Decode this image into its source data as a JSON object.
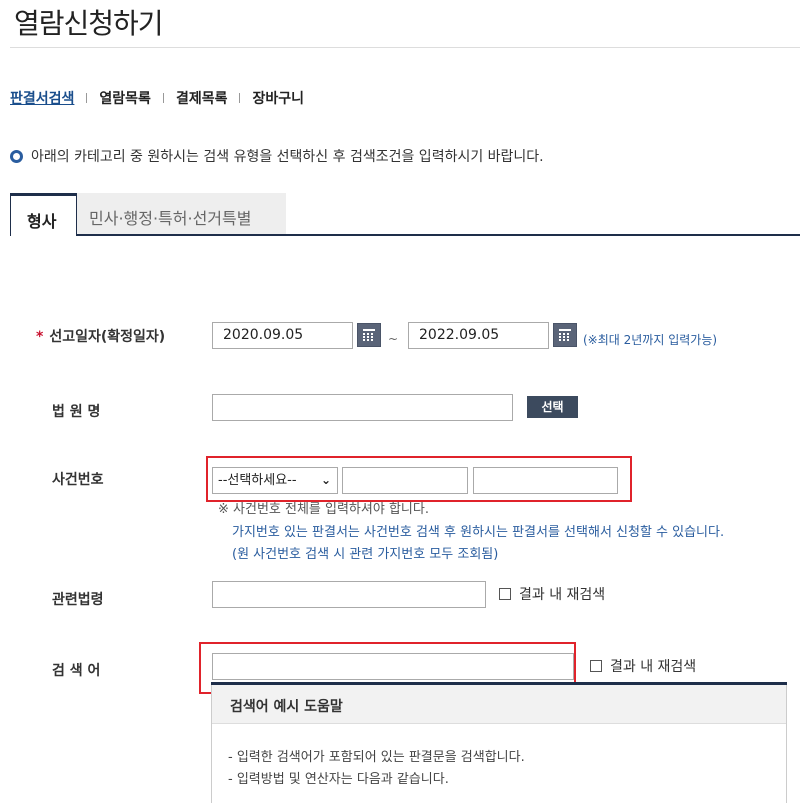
{
  "page": {
    "title": "열람신청하기",
    "subnav": [
      {
        "label": "판결서검색",
        "active": true
      },
      {
        "label": "열람목록",
        "active": false
      },
      {
        "label": "결제목록",
        "active": false
      },
      {
        "label": "장바구니",
        "active": false
      }
    ],
    "info": "아래의 카테고리 중 원하시는 검색 유형을 선택하신 후 검색조건을 입력하시기 바랍니다."
  },
  "tabs": [
    {
      "label": "형사",
      "active": true
    },
    {
      "label": "민사·행정·특허·선거특별",
      "active": false
    }
  ],
  "form": {
    "date": {
      "required_mark": "*",
      "label": "선고일자(확정일자)",
      "start": "2020.09.05",
      "tilde": "~",
      "end": "2022.09.05",
      "note": "(※최대 2년까지 입력가능)"
    },
    "court": {
      "label": "법 원 명",
      "value": "",
      "select_button": "선택"
    },
    "case_number": {
      "label": "사건번호",
      "select_value": "--선택하세요--",
      "field2": "",
      "field3": "",
      "note1": "※ 사건번호 전체를 입력하셔야 합니다.",
      "note2": "가지번호 있는 판결서는 사건번호 검색 후 원하시는 판결서를 선택해서 신청할 수 있습니다.",
      "note3": "(원 사건번호 검색 시 관련 가지번호 모두 조회됨)"
    },
    "law": {
      "label": "관련법령",
      "value": "",
      "research_label": "결과 내 재검색"
    },
    "keyword": {
      "label": "검 색 어",
      "value": "",
      "research_label": "결과 내 재검색"
    }
  },
  "help": {
    "title": "검색어 예시 도움말",
    "lines": [
      "- 입력한 검색어가 포함되어 있는 판결문을 검색합니다.",
      "- 입력방법 및 연산자는 다음과 같습니다."
    ]
  },
  "colors": {
    "accent": "#1e2e4a",
    "link": "#1a4e8c",
    "required": "#c8102e",
    "highlight": "#e0232b"
  }
}
